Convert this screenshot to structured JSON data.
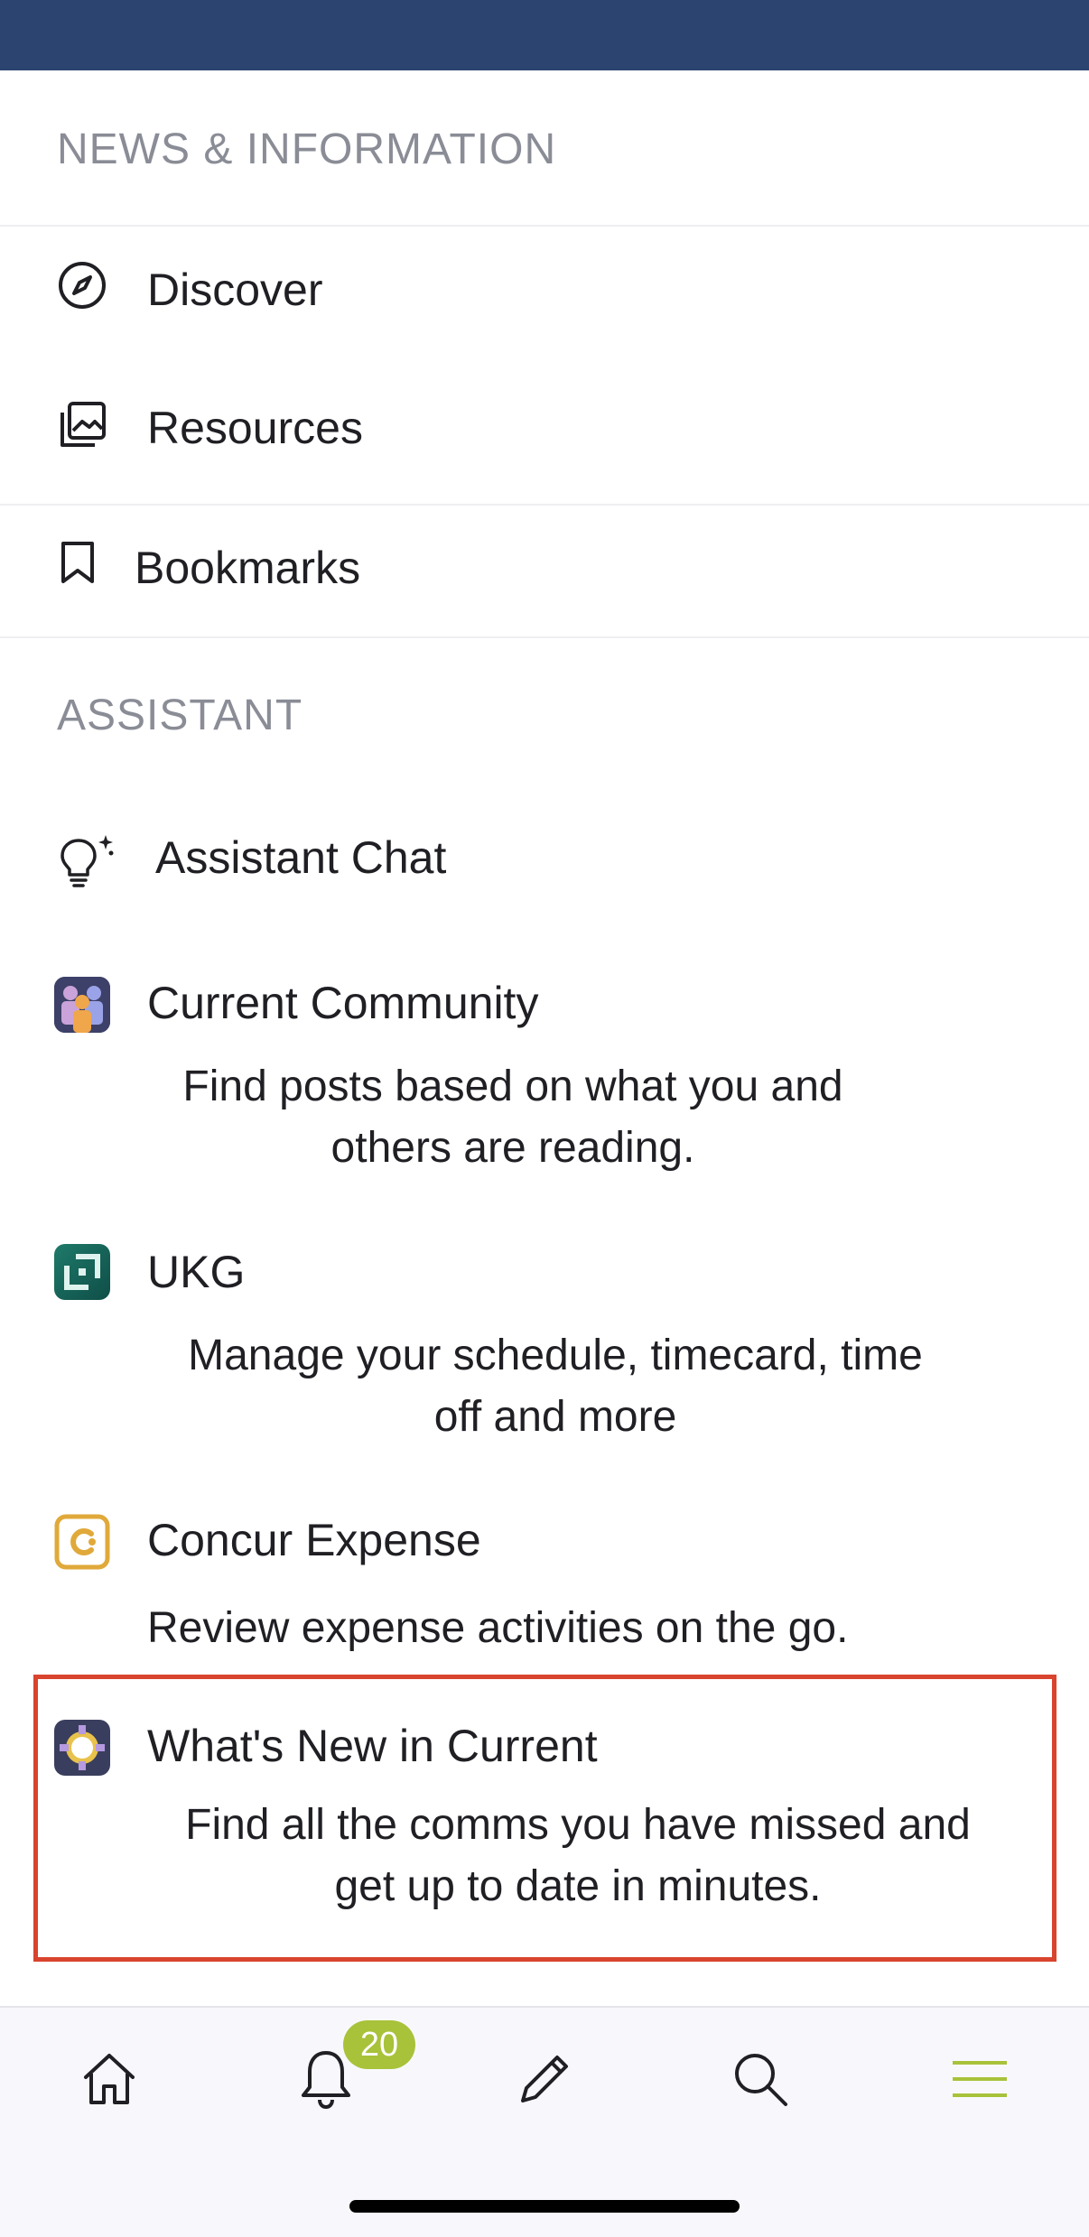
{
  "sections": {
    "news": {
      "header": "NEWS & INFORMATION",
      "items": [
        {
          "label": "Discover",
          "icon": "compass-icon"
        },
        {
          "label": "Resources",
          "icon": "photo-library-icon"
        },
        {
          "label": "Bookmarks",
          "icon": "bookmark-icon"
        }
      ]
    },
    "assistant": {
      "header": "ASSISTANT",
      "chat": {
        "label": "Assistant Chat",
        "icon": "lightbulb-sparkle-icon"
      },
      "apps": [
        {
          "title": "Current Community",
          "desc_line1": "Find posts based on what you and",
          "desc_line2": "others are reading.",
          "icon": "community-app-icon"
        },
        {
          "title": "UKG",
          "desc_line1": "Manage your schedule, timecard, time",
          "desc_line2": "off and more",
          "icon": "ukg-app-icon"
        },
        {
          "title": "Concur Expense",
          "desc_line1": "Review expense activities on the go.",
          "desc_line2": "",
          "icon": "concur-app-icon"
        },
        {
          "title": "What's New in Current",
          "desc_line1": "Find all the comms you have missed and",
          "desc_line2": "get up to date in minutes.",
          "icon": "whats-new-app-icon"
        }
      ]
    }
  },
  "tabbar": {
    "notification_count": "20",
    "tabs": [
      "home-icon",
      "bell-icon",
      "pencil-icon",
      "search-icon",
      "menu-icon"
    ],
    "active_color": "#a8c23a"
  },
  "colors": {
    "topbar": "#2b4470",
    "highlight": "#d9442f"
  }
}
